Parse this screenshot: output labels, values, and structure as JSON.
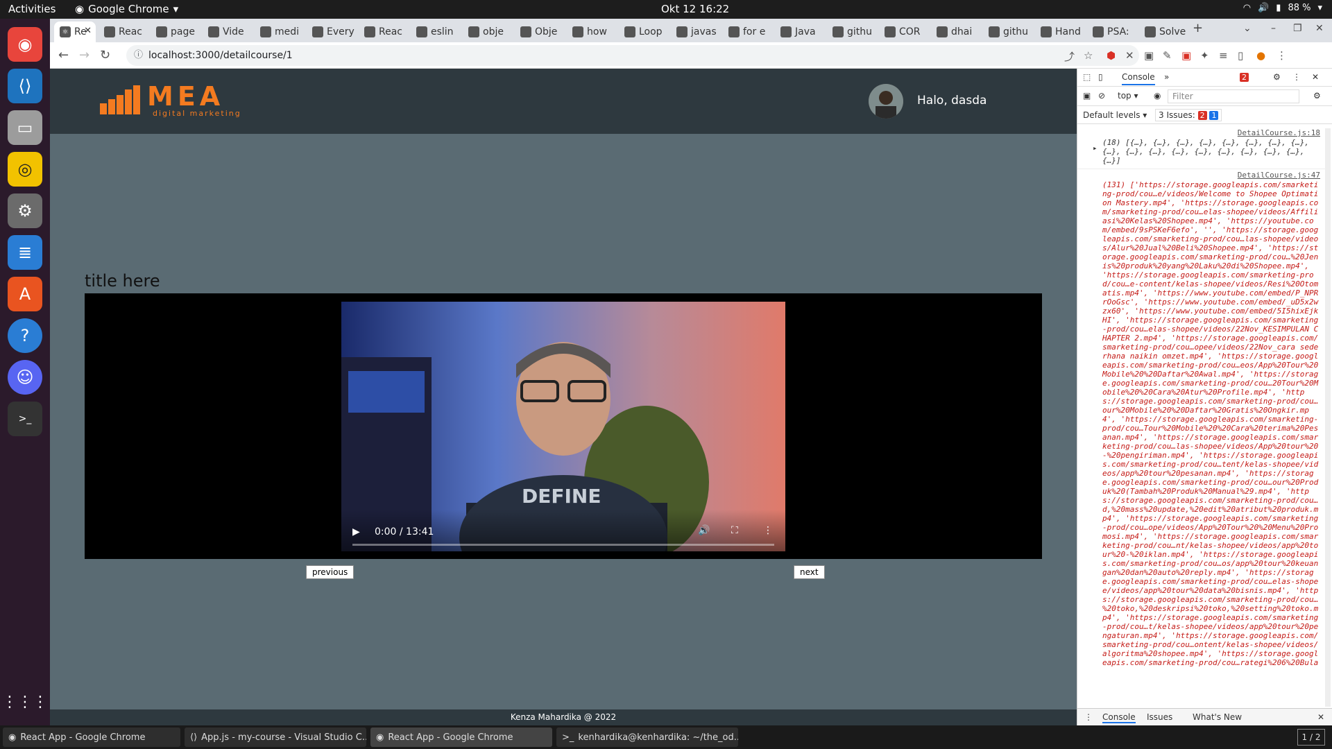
{
  "topbar": {
    "activities": "Activities",
    "app": "Google Chrome",
    "clock": "Okt 12  16:22",
    "battery": "88 %"
  },
  "dock": {
    "items": [
      "Google Chrome",
      "Visual Studio Code",
      "Files",
      "Rhythmbox",
      "Settings",
      "LibreOffice Writer",
      "Ubuntu Software",
      "Help",
      "Discord",
      "Terminal"
    ]
  },
  "tabs": [
    "Re",
    "Reac",
    "page",
    "Vide",
    "medi",
    "Every",
    "Reac",
    "eslin",
    "obje",
    "Obje",
    "how",
    "Loop",
    "javas",
    "for e",
    "Java",
    "githu",
    "COR",
    "dhai",
    "githu",
    "Hand",
    "PSA:",
    "Solve"
  ],
  "omnibox": {
    "url": "localhost:3000/detailcourse/1"
  },
  "app": {
    "logo_text": "MEA",
    "logo_sub": "digital marketing",
    "greeting": "Halo, dasda",
    "title": "title here",
    "previous": "previous",
    "next": "next",
    "footer": "Kenza Mahardika @ 2022"
  },
  "video": {
    "time": "0:00 / 13:41"
  },
  "devtools": {
    "console_tab": "Console",
    "context": "top",
    "filter_placeholder": "Filter",
    "levels": "Default levels",
    "issues_label": "3 Issues:",
    "issues_red": "2",
    "issues_blue": "1",
    "error_badge": "2",
    "log1_src": "DetailCourse.js:18",
    "log1_text": "(18) [{…}, {…}, {…}, {…}, {…}, {…}, {…}, {…}, {…}, {…}, {…}, {…}, {…}, {…}, {…}, {…}, {…}, {…}]",
    "log2_src": "DetailCourse.js:47",
    "log2_text": "(131) ['https://storage.googleapis.com/smarketing-prod/cou…e/videos/Welcome to Shopee Optimation Mastery.mp4', 'https://storage.googleapis.com/smarketing-prod/cou…elas-shopee/videos/Affiliasi%20Kelas%20Shopee.mp4', 'https://youtube.com/embed/9sPSKeF6efo', '', 'https://storage.googleapis.com/smarketing-prod/cou…las-shopee/videos/Alur%20Jual%20Beli%20Shopee.mp4', 'https://storage.googleapis.com/smarketing-prod/cou…%20Jenis%20produk%20yang%20Laku%20di%20Shopee.mp4', 'https://storage.googleapis.com/smarketing-prod/cou…e-content/kelas-shopee/videos/Resi%20Otomatis.mp4', 'https://www.youtube.com/embed/P_NPRrOoGsc', 'https://www.youtube.com/embed/_uD5x2wzx60', 'https://www.youtube.com/embed/5I5hixEjkHI', 'https://storage.googleapis.com/smarketing-prod/cou…elas-shopee/videos/22Nov_KESIMPULAN CHAPTER 2.mp4', 'https://storage.googleapis.com/smarketing-prod/cou…opee/videos/22Nov_cara sederhana naikin omzet.mp4', 'https://storage.googleapis.com/smarketing-prod/cou…eos/App%20Tour%20Mobile%20%20Daftar%20Awal.mp4', 'https://storage.googleapis.com/smarketing-prod/cou…20Tour%20Mobile%20%20Cara%20Atur%20Profile.mp4', 'https://storage.googleapis.com/smarketing-prod/cou…our%20Mobile%20%20Daftar%20Gratis%20Ongkir.mp4', 'https://storage.googleapis.com/smarketing-prod/cou…Tour%20Mobile%20%20Cara%20terima%20Pesanan.mp4', 'https://storage.googleapis.com/smarketing-prod/cou…las-shopee/videos/App%20tour%20-%20pengiriman.mp4', 'https://storage.googleapis.com/smarketing-prod/cou…tent/kelas-shopee/videos/app%20tour%20pesanan.mp4', 'https://storage.googleapis.com/smarketing-prod/cou…our%20Produk%20(Tambah%20Produk%20Manual%29.mp4', 'https://storage.googleapis.com/smarketing-prod/cou…d,%20mass%20update,%20edit%20atribut%20produk.mp4', 'https://storage.googleapis.com/smarketing-prod/cou…ope/videos/App%20Tour%20%20Menu%20Promosi.mp4', 'https://storage.googleapis.com/smarketing-prod/cou…nt/kelas-shopee/videos/app%20tour%20-%20iklan.mp4', 'https://storage.googleapis.com/smarketing-prod/cou…os/app%20tour%20keuangan%20dan%20auto%20reply.mp4', 'https://storage.googleapis.com/smarketing-prod/cou…elas-shopee/videos/app%20tour%20data%20bisnis.mp4', 'https://storage.googleapis.com/smarketing-prod/cou…%20toko,%20deskripsi%20toko,%20setting%20toko.mp4', 'https://storage.googleapis.com/smarketing-prod/cou…t/kelas-shopee/videos/app%20tour%20pengaturan.mp4', 'https://storage.googleapis.com/smarketing-prod/cou…ontent/kelas-shopee/videos/algoritma%20shopee.mp4', 'https://storage.googleapis.com/smarketing-prod/cou…rategi%206%20Bula",
    "drawer_tabs": [
      "Console",
      "Issues",
      "What's New"
    ]
  },
  "taskbar": {
    "items": [
      "React App - Google Chrome",
      "App.js - my-course - Visual Studio C...",
      "React App - Google Chrome",
      "kenhardika@kenhardika: ~/the_od..."
    ],
    "workspace": "1 / 2"
  }
}
